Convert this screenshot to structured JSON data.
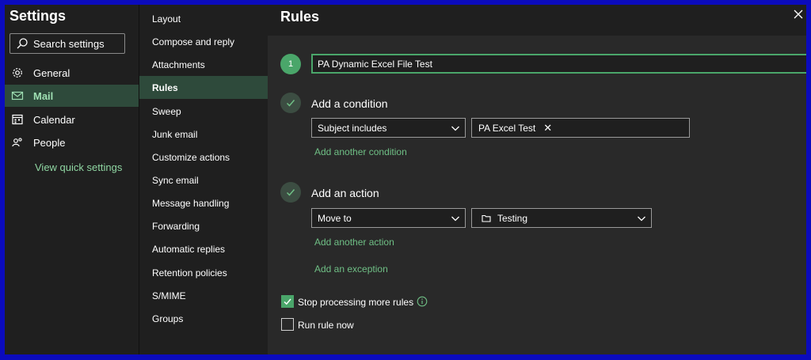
{
  "left": {
    "title": "Settings",
    "search_placeholder": "Search settings",
    "items": [
      {
        "label": "General",
        "icon": "gear-icon"
      },
      {
        "label": "Mail",
        "icon": "mail-icon"
      },
      {
        "label": "Calendar",
        "icon": "calendar-icon"
      },
      {
        "label": "People",
        "icon": "people-icon"
      }
    ],
    "quick_settings": "View quick settings"
  },
  "middle": {
    "items": [
      "Layout",
      "Compose and reply",
      "Attachments",
      "Rules",
      "Sweep",
      "Junk email",
      "Customize actions",
      "Sync email",
      "Message handling",
      "Forwarding",
      "Automatic replies",
      "Retention policies",
      "S/MIME",
      "Groups"
    ],
    "selected": "Rules"
  },
  "rules": {
    "title": "Rules",
    "step_number": "1",
    "rule_name": "PA Dynamic Excel File Test",
    "condition": {
      "title": "Add a condition",
      "type": "Subject includes",
      "value_chip": "PA Excel Test",
      "add_link": "Add another condition"
    },
    "action": {
      "title": "Add an action",
      "type": "Move to",
      "folder": "Testing",
      "add_link": "Add another action"
    },
    "exception_link": "Add an exception",
    "stop_processing": {
      "label": "Stop processing more rules",
      "checked": true
    },
    "run_now": {
      "label": "Run rule now",
      "checked": false
    }
  },
  "colors": {
    "accent": "#4aa66a",
    "frame": "#0b0bbd"
  }
}
